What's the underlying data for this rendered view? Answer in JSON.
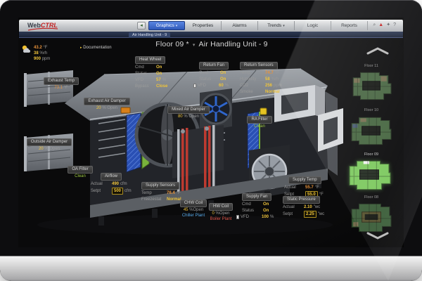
{
  "toolbar": {
    "logo_web": "Web",
    "logo_ctrl": "CTRL",
    "back_label": "◂",
    "tabs": [
      {
        "label": "Graphics",
        "dropdown": "▾"
      },
      {
        "label": "Properties",
        "dropdown": ""
      },
      {
        "label": "Alarms",
        "dropdown": ""
      },
      {
        "label": "Trends",
        "dropdown": "▾"
      },
      {
        "label": "Logic",
        "dropdown": ""
      },
      {
        "label": "Reports",
        "dropdown": ""
      }
    ],
    "icons": {
      "search": "⌕",
      "alarm": "▲",
      "settings": "✦",
      "help": "?"
    }
  },
  "breadcrumb": {
    "label": "Air Handling Unit - 9"
  },
  "header": {
    "location": "Floor 09 *",
    "separator": "▾",
    "title": "Air Handling Unit - 9"
  },
  "weather": {
    "temp": "43.2",
    "temp_unit": "°F",
    "humidity": "38",
    "humidity_unit": "%rh",
    "co2": "900",
    "co2_unit": "ppm"
  },
  "links": {
    "documentation": "Documentation",
    "doc_arrow": "▸",
    "chiller": "Chiller Plant",
    "boiler": "Boiler Plant"
  },
  "callouts": {
    "exhaust_temp": {
      "label": "Exhaust Temp",
      "value": "73.1",
      "unit": "°F"
    },
    "heat_wheel": {
      "label": "Heat Wheel",
      "rows": [
        {
          "name": "Cmd",
          "value": "On"
        },
        {
          "name": "Status",
          "value": "On"
        },
        {
          "name": "VFD",
          "value": "57",
          "unit": "%"
        },
        {
          "name": "Bypass",
          "value": "Close"
        }
      ]
    },
    "return_fan": {
      "label": "Return Fan",
      "rows": [
        {
          "name": "Cmd",
          "value": "On"
        },
        {
          "name": "Status",
          "value": "On"
        },
        {
          "name": "VFD",
          "value": "60",
          "unit": "%"
        }
      ]
    },
    "return_sensors": {
      "label": "Return Sensors",
      "rows": [
        {
          "name": "Temp",
          "value": "74.7",
          "unit": "°F"
        },
        {
          "name": "Humidity",
          "value": "58",
          "unit": "%rh"
        },
        {
          "name": "CO2",
          "value": "256",
          "unit": "ppm"
        },
        {
          "name": "Smoke",
          "value": "Normal",
          "unit": ""
        }
      ]
    },
    "exhaust_air_damper": {
      "label": "Exhaust Air Damper",
      "value": "20",
      "unit": "% Open"
    },
    "mixed_air_damper": {
      "label": "Mixed Air Damper",
      "value": "80",
      "unit": "% Open"
    },
    "ra_filter": {
      "label": "RA Filter",
      "value": "Clean"
    },
    "outside_air_damper": {
      "label": "Outside Air Damper",
      "value": "20",
      "unit": "% Open"
    },
    "oa_filter": {
      "label": "OA Filter",
      "value": "Clean"
    },
    "airflow": {
      "label": "Airflow",
      "rows": [
        {
          "name": "Actual",
          "value": "490",
          "unit": "cfm"
        },
        {
          "name": "Setpt",
          "value": "500",
          "unit": "cfm"
        }
      ]
    },
    "supply_sensors": {
      "label": "Supply Sensors",
      "rows": [
        {
          "name": "Temp",
          "value": "76.4",
          "unit": "°F"
        },
        {
          "name": "Freezestat",
          "value": "Normal",
          "unit": ""
        }
      ]
    },
    "chw_coil": {
      "label": "CHW Coil",
      "value": "45",
      "unit": "%Open"
    },
    "hw_coil": {
      "label": "HW Coil",
      "value": "0",
      "unit": "%Open"
    },
    "supply_temp": {
      "label": "Supply Temp",
      "rows": [
        {
          "name": "Actual",
          "value": "55.7",
          "unit": "°F"
        },
        {
          "name": "Setpt",
          "value": "55.0",
          "unit": "°F"
        }
      ]
    },
    "static_pressure": {
      "label": "Static Pressure",
      "rows": [
        {
          "name": "Actual",
          "value": "2.10",
          "unit": "\"wc"
        },
        {
          "name": "Setpt",
          "value": "2.25",
          "unit": "\"wc"
        }
      ]
    },
    "supply_fan": {
      "label": "Supply Fan",
      "rows": [
        {
          "name": "Cmd",
          "value": "On"
        },
        {
          "name": "Status",
          "value": "On"
        },
        {
          "name": "VFD",
          "value": "100",
          "unit": "%"
        }
      ]
    }
  },
  "sidebar": {
    "floors": [
      {
        "label": "Floor 11",
        "selected": false
      },
      {
        "label": "Floor 10",
        "selected": false
      },
      {
        "label": "Floor 09",
        "selected": true
      },
      {
        "label": "Floor 08",
        "selected": false
      }
    ]
  },
  "colors": {
    "value_yellow": "#eec33a",
    "value_orange": "#e8923a",
    "status_green": "#9cc93e",
    "link_blue": "#57a9e8",
    "link_red": "#e0564a",
    "tab_active_blue": "#2d56b6",
    "floor_selected_green": "#7cc95e"
  }
}
